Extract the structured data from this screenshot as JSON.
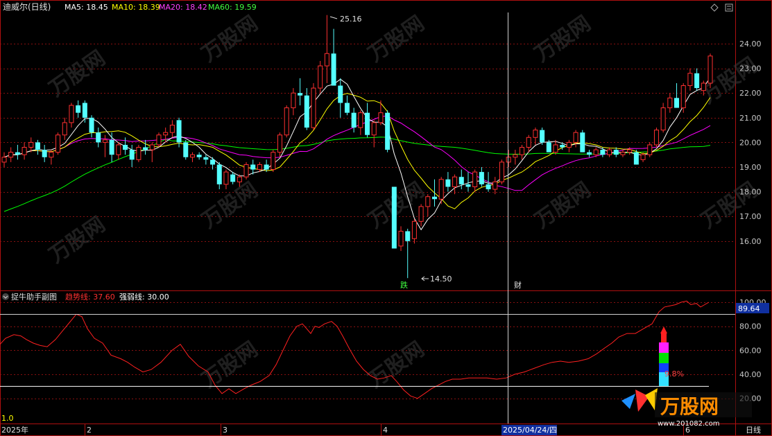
{
  "chart_data": [
    {
      "type": "candlestick",
      "title": "迪威尔(日线)",
      "series": [
        {
          "name": "MA5",
          "label": "MA5: 18.45",
          "color": "#ffffff"
        },
        {
          "name": "MA10",
          "label": "MA10: 18.39",
          "color": "#ffff00"
        },
        {
          "name": "MA20",
          "label": "MA20: 18.42",
          "color": "#ff00ff"
        },
        {
          "name": "MA60",
          "label": "MA60: 19.59",
          "color": "#00ff00"
        }
      ],
      "ylim": [
        14.6,
        25.3
      ],
      "y_ticks": [
        "24.00",
        "23.00",
        "22.00",
        "21.00",
        "20.00",
        "19.00",
        "18.00",
        "17.00",
        "16.00"
      ],
      "annotations": {
        "high": "25.16",
        "low": "14.50",
        "mark_fall": "跌",
        "mark_fin": "财"
      },
      "candles_ohlc": [
        [
          19.2,
          19.6,
          19.0,
          19.4
        ],
        [
          19.4,
          19.8,
          19.2,
          19.6
        ],
        [
          19.6,
          19.9,
          19.3,
          19.5
        ],
        [
          19.5,
          20.0,
          19.3,
          19.8
        ],
        [
          19.8,
          20.2,
          19.6,
          20.0
        ],
        [
          20.0,
          20.1,
          19.5,
          19.7
        ],
        [
          19.7,
          19.9,
          19.2,
          19.4
        ],
        [
          19.4,
          19.7,
          19.1,
          19.6
        ],
        [
          19.6,
          20.4,
          19.5,
          20.3
        ],
        [
          20.3,
          21.0,
          20.1,
          20.8
        ],
        [
          20.8,
          21.6,
          20.6,
          21.5
        ],
        [
          21.5,
          21.7,
          21.0,
          21.2
        ],
        [
          21.6,
          21.7,
          20.8,
          21.0
        ],
        [
          21.0,
          21.1,
          20.2,
          20.4
        ],
        [
          20.4,
          20.6,
          19.8,
          20.0
        ],
        [
          20.0,
          20.3,
          19.4,
          20.1
        ],
        [
          20.1,
          20.4,
          19.2,
          19.5
        ],
        [
          19.5,
          20.0,
          19.3,
          19.9
        ],
        [
          19.9,
          20.2,
          19.5,
          19.7
        ],
        [
          19.7,
          19.9,
          19.0,
          19.3
        ],
        [
          19.3,
          19.9,
          19.2,
          19.8
        ],
        [
          19.8,
          20.1,
          19.5,
          19.7
        ],
        [
          19.7,
          20.0,
          19.2,
          19.9
        ],
        [
          19.9,
          20.4,
          19.8,
          20.3
        ],
        [
          20.3,
          20.6,
          20.0,
          20.4
        ],
        [
          20.4,
          20.9,
          20.2,
          20.7
        ],
        [
          20.9,
          21.0,
          19.8,
          20.0
        ],
        [
          20.0,
          20.1,
          19.3,
          19.4
        ],
        [
          19.4,
          19.6,
          19.2,
          19.5
        ],
        [
          19.5,
          19.6,
          19.3,
          19.4
        ],
        [
          19.4,
          19.5,
          19.1,
          19.3
        ],
        [
          19.3,
          19.4,
          18.9,
          19.1
        ],
        [
          19.1,
          19.2,
          18.1,
          18.3
        ],
        [
          18.3,
          18.9,
          18.1,
          18.8
        ],
        [
          18.7,
          18.8,
          18.3,
          18.4
        ],
        [
          18.4,
          18.7,
          18.2,
          18.6
        ],
        [
          18.6,
          19.2,
          18.5,
          19.1
        ],
        [
          19.1,
          19.3,
          18.7,
          18.9
        ],
        [
          18.9,
          19.2,
          18.8,
          19.1
        ],
        [
          19.1,
          19.3,
          18.8,
          18.9
        ],
        [
          18.9,
          19.7,
          18.8,
          19.6
        ],
        [
          19.6,
          20.4,
          19.4,
          20.3
        ],
        [
          20.3,
          21.5,
          20.2,
          21.4
        ],
        [
          21.4,
          22.2,
          21.1,
          22.0
        ],
        [
          22.0,
          22.6,
          21.5,
          21.9
        ],
        [
          21.9,
          22.2,
          20.5,
          20.6
        ],
        [
          20.6,
          22.4,
          20.5,
          22.2
        ],
        [
          22.2,
          23.3,
          22.0,
          23.1
        ],
        [
          23.1,
          25.16,
          22.4,
          23.6
        ],
        [
          23.6,
          24.6,
          22.3,
          22.3
        ],
        [
          22.3,
          22.6,
          21.0,
          21.6
        ],
        [
          21.6,
          21.9,
          21.1,
          21.2
        ],
        [
          21.2,
          21.4,
          20.4,
          20.6
        ],
        [
          20.6,
          21.3,
          20.3,
          21.2
        ],
        [
          21.2,
          21.6,
          20.2,
          20.3
        ],
        [
          20.3,
          20.9,
          19.8,
          20.8
        ],
        [
          20.8,
          21.7,
          20.7,
          21.2
        ],
        [
          21.2,
          21.3,
          19.6,
          19.7
        ],
        [
          18.2,
          18.2,
          15.7,
          15.7
        ],
        [
          15.8,
          16.6,
          15.6,
          16.4
        ],
        [
          16.4,
          16.5,
          14.5,
          16.0
        ],
        [
          16.1,
          16.9,
          15.9,
          16.8
        ],
        [
          16.8,
          17.5,
          16.6,
          17.4
        ],
        [
          17.4,
          17.9,
          17.0,
          17.8
        ],
        [
          17.8,
          18.5,
          17.4,
          17.7
        ],
        [
          17.7,
          18.6,
          17.5,
          18.5
        ],
        [
          18.5,
          18.8,
          18.0,
          18.2
        ],
        [
          18.2,
          18.7,
          17.9,
          18.6
        ],
        [
          18.6,
          18.9,
          18.1,
          18.3
        ],
        [
          18.3,
          18.8,
          18.0,
          18.2
        ],
        [
          18.2,
          18.9,
          18.0,
          18.8
        ],
        [
          18.8,
          19.0,
          18.2,
          18.3
        ],
        [
          18.3,
          18.8,
          18.0,
          18.1
        ],
        [
          18.1,
          18.6,
          17.9,
          18.4
        ],
        [
          18.4,
          19.3,
          18.3,
          19.2
        ],
        [
          19.2,
          19.7,
          19.0,
          19.4
        ],
        [
          19.4,
          19.7,
          19.1,
          19.5
        ],
        [
          19.5,
          19.9,
          19.3,
          19.8
        ],
        [
          19.8,
          20.3,
          19.6,
          20.2
        ],
        [
          20.2,
          20.6,
          19.9,
          20.5
        ],
        [
          20.5,
          20.6,
          19.9,
          20.0
        ],
        [
          20.0,
          20.1,
          19.6,
          19.6
        ],
        [
          19.6,
          20.1,
          19.5,
          19.9
        ],
        [
          19.9,
          20.0,
          19.7,
          19.8
        ],
        [
          19.8,
          20.1,
          19.6,
          20.0
        ],
        [
          20.0,
          20.5,
          19.8,
          20.4
        ],
        [
          20.4,
          20.5,
          19.6,
          19.6
        ],
        [
          19.6,
          19.7,
          19.4,
          19.5
        ],
        [
          19.5,
          19.8,
          19.4,
          19.7
        ],
        [
          19.7,
          19.8,
          19.4,
          19.5
        ],
        [
          19.5,
          19.8,
          19.4,
          19.7
        ],
        [
          19.7,
          19.8,
          19.4,
          19.5
        ],
        [
          19.5,
          19.7,
          19.4,
          19.6
        ],
        [
          19.6,
          19.8,
          19.5,
          19.7
        ],
        [
          19.6,
          19.7,
          19.1,
          19.1
        ],
        [
          19.3,
          19.6,
          19.2,
          19.5
        ],
        [
          19.5,
          20.0,
          19.4,
          19.9
        ],
        [
          19.9,
          20.6,
          19.8,
          20.5
        ],
        [
          20.5,
          21.6,
          20.4,
          21.4
        ],
        [
          21.4,
          22.0,
          21.2,
          21.8
        ],
        [
          21.8,
          22.4,
          21.4,
          21.4
        ],
        [
          21.4,
          22.4,
          21.2,
          22.3
        ],
        [
          22.3,
          23.0,
          22.1,
          22.8
        ],
        [
          22.8,
          23.0,
          22.1,
          22.2
        ],
        [
          22.1,
          22.5,
          21.9,
          22.4
        ],
        [
          22.4,
          23.6,
          22.2,
          23.5
        ]
      ]
    },
    {
      "type": "line",
      "title": "捉牛助手副图",
      "series": [
        {
          "name": "趋势线",
          "label": "趋势线: 37.60",
          "color": "#ff2020"
        },
        {
          "name": "强弱线",
          "label": "强弱线: 30.00",
          "color": "#ffffff"
        }
      ],
      "ylim": [
        12.8,
        100
      ],
      "y_ticks": [
        "100.00",
        "80.00",
        "60.00",
        "40.00",
        "20.00"
      ],
      "crosshair_value": "89.64",
      "percent_label": "9.8%",
      "trend_points": [
        [
          0,
          65
        ],
        [
          8,
          70
        ],
        [
          20,
          73
        ],
        [
          30,
          72
        ],
        [
          38,
          69
        ],
        [
          48,
          66
        ],
        [
          58,
          64
        ],
        [
          68,
          63
        ],
        [
          80,
          69
        ],
        [
          90,
          76
        ],
        [
          100,
          83
        ],
        [
          110,
          90
        ],
        [
          118,
          88
        ],
        [
          126,
          78
        ],
        [
          136,
          70
        ],
        [
          148,
          66
        ],
        [
          160,
          56
        ],
        [
          174,
          53
        ],
        [
          184,
          50
        ],
        [
          194,
          46
        ],
        [
          206,
          42
        ],
        [
          218,
          44
        ],
        [
          232,
          50
        ],
        [
          248,
          60
        ],
        [
          260,
          65
        ],
        [
          272,
          55
        ],
        [
          286,
          47
        ],
        [
          300,
          42
        ],
        [
          310,
          31
        ],
        [
          320,
          24
        ],
        [
          330,
          28
        ],
        [
          340,
          24
        ],
        [
          352,
          28
        ],
        [
          362,
          31
        ],
        [
          375,
          34
        ],
        [
          388,
          39
        ],
        [
          398,
          48
        ],
        [
          408,
          60
        ],
        [
          418,
          72
        ],
        [
          428,
          80
        ],
        [
          436,
          82
        ],
        [
          442,
          78
        ],
        [
          448,
          74
        ],
        [
          454,
          80
        ],
        [
          460,
          79
        ],
        [
          468,
          82
        ],
        [
          478,
          84
        ],
        [
          486,
          80
        ],
        [
          494,
          72
        ],
        [
          504,
          61
        ],
        [
          514,
          51
        ],
        [
          524,
          44
        ],
        [
          534,
          39
        ],
        [
          544,
          36
        ],
        [
          554,
          37
        ],
        [
          564,
          39
        ],
        [
          572,
          34
        ],
        [
          582,
          27
        ],
        [
          592,
          22
        ],
        [
          602,
          20
        ],
        [
          612,
          24
        ],
        [
          622,
          28
        ],
        [
          632,
          31
        ],
        [
          642,
          34
        ],
        [
          652,
          36
        ],
        [
          664,
          36
        ],
        [
          676,
          37
        ],
        [
          690,
          37
        ],
        [
          702,
          37
        ],
        [
          716,
          36
        ],
        [
          730,
          37
        ],
        [
          742,
          40
        ],
        [
          756,
          42
        ],
        [
          770,
          45
        ],
        [
          784,
          48
        ],
        [
          796,
          50
        ],
        [
          808,
          51
        ],
        [
          820,
          50
        ],
        [
          834,
          51
        ],
        [
          848,
          53
        ],
        [
          860,
          57
        ],
        [
          872,
          62
        ],
        [
          882,
          66
        ],
        [
          892,
          71
        ],
        [
          904,
          74
        ],
        [
          916,
          74
        ],
        [
          928,
          78
        ],
        [
          940,
          82
        ],
        [
          950,
          92
        ],
        [
          958,
          96
        ],
        [
          966,
          97
        ],
        [
          974,
          98
        ],
        [
          982,
          100
        ],
        [
          990,
          101
        ],
        [
          996,
          98
        ],
        [
          1004,
          99
        ],
        [
          1010,
          96
        ],
        [
          1016,
          98
        ],
        [
          1022,
          100
        ]
      ],
      "strength_value": 30
    }
  ],
  "x_axis": {
    "labels": [
      "2025年",
      "2",
      "3",
      "4",
      "6"
    ],
    "crosshair_date": "2025/04/24/四",
    "period": "日线"
  },
  "corner_label": "1.0",
  "watermark": {
    "text": "万股网",
    "url": "www.201082.com"
  }
}
